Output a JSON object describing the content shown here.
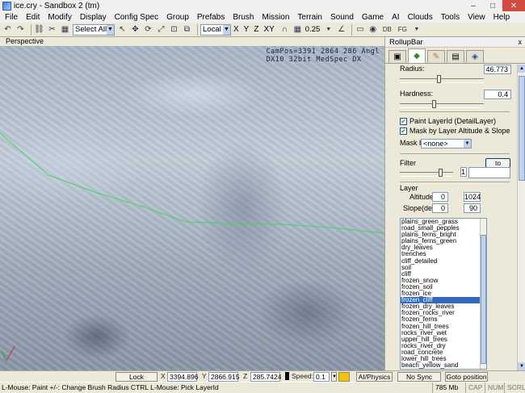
{
  "window": {
    "title": "ice.cry - Sandbox 2 (tm)",
    "minimize": "–",
    "maximize": "□",
    "close": "✕"
  },
  "menu": [
    "File",
    "Edit",
    "Modify",
    "Display",
    "Config Spec",
    "Group",
    "Prefabs",
    "Brush",
    "Mission",
    "Terrain",
    "Sound",
    "Game",
    "AI",
    "Clouds",
    "Tools",
    "View",
    "Help"
  ],
  "toolbar": {
    "selection": "Select All",
    "coord_system": "Local",
    "axes": [
      "X",
      "Y",
      "Z",
      "XY"
    ],
    "grid_value": "0.25"
  },
  "viewport": {
    "title": "Perspective",
    "info_line1": "CamPos=3391 2864 286 Angl",
    "info_line2": "DX10 32bit MedSpec DX"
  },
  "rollup": {
    "title": "RollupBar",
    "close": "x",
    "tabs": [
      "select-objects",
      "terrain",
      "modeling",
      "display",
      "layers"
    ],
    "radius_label": "Radius:",
    "radius_value": "46.773",
    "radius_fraction": 0.46,
    "hardness_label": "Hardness:",
    "hardness_value": "0.4",
    "hardness_fraction": 0.4,
    "paint_layer_label": "Paint LayerId (DetailLayer)",
    "mask_altitude_label": "Mask by Layer Altitude & Slope",
    "mask_by_label": "Mask by",
    "mask_by_value": "<none>",
    "filter_label": "Filter",
    "to_layer_button": "to Layer",
    "filter_value": "1",
    "layer_label": "Layer",
    "altitude_label": "Altitude",
    "altitude_min": "0",
    "altitude_max": "1024",
    "slope_label": "Slope(deg.)",
    "slope_min": "0",
    "slope_max": "90",
    "layers": [
      "plains_green_grass",
      "road_small_pepples",
      "plains_ferns_bright",
      "plains_ferns_green",
      "dry_leaves",
      "trenches",
      "cliff_detailed",
      "soil",
      "cliff",
      "frozen_snow",
      "frozen_soil",
      "frozen_ice",
      "frozen_cliff",
      "frozen_dry_leaves",
      "frozen_rocks_river",
      "frozen_ferns",
      "frozen_hill_trees",
      "rocks_river_wet",
      "upper_hill_trees",
      "rocks_river_dry",
      "road_concrete",
      "lower_hill_trees",
      "beach_yellow_sand"
    ],
    "selected_layer": "frozen_cliff"
  },
  "bottom": {
    "lock_selection": "Lock Selection",
    "x_label": "X",
    "x_value": "3394.896",
    "y_label": "Y",
    "y_value": "2866.915",
    "z_label": "Z",
    "z_value": "285.7424",
    "speed_label": "Speed:",
    "speed_value": "0.1",
    "ai_physics": "AI/Physics",
    "no_sync_player": "No Sync Player",
    "goto_position": "Goto position"
  },
  "status": {
    "hint": "L-Mouse: Paint  +/-: Change Brush Radius  CTRL L-Mouse: Pick LayerId",
    "memory": "785 Mb",
    "cap": "CAP",
    "num": "NUM",
    "scrl": "SCRL"
  },
  "colors": {
    "path_line": "#3adc5a",
    "selection": "#316ac5"
  }
}
